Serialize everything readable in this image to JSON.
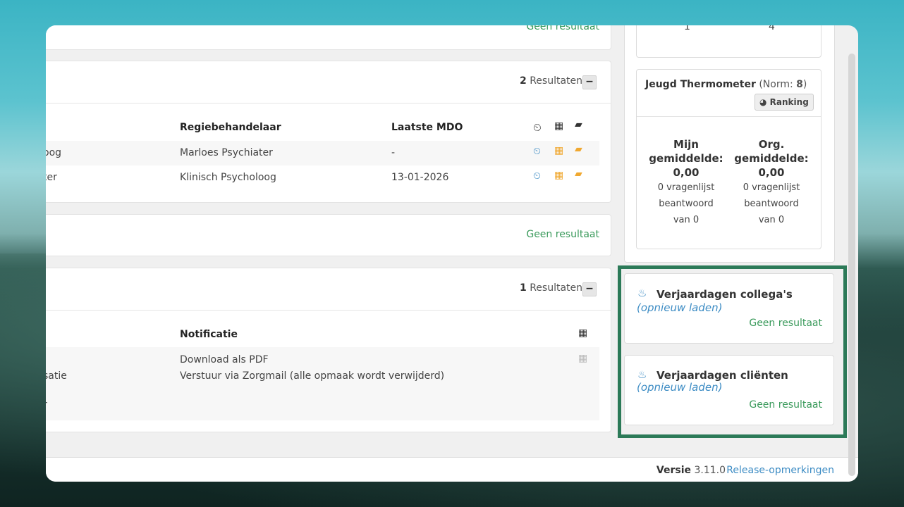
{
  "top_panel": {
    "status": "Geen resultaat"
  },
  "mdo_panel": {
    "count": "2",
    "count_label": "Resultaten",
    "collapse": "−",
    "headers": {
      "regie": "Regiebehandelaar",
      "laatste": "Laatste MDO"
    },
    "rows": [
      {
        "name_partial": "oog",
        "regie": "Marloes Psychiater",
        "laatste": "-"
      },
      {
        "name_partial": "ter",
        "regie": "Klinisch Psycholoog",
        "laatste": "13-01-2026"
      }
    ]
  },
  "empty_panel": {
    "status": "Geen resultaat"
  },
  "notif_panel": {
    "count": "1",
    "count_label": "Resultaten",
    "collapse": "−",
    "header": "Notificatie",
    "row": {
      "left_partial": "satie",
      "left_partial2": "r",
      "download": "Download als PDF",
      "zorgmail": "Verstuur via Zorgmail (alle opmaak wordt verwijderd)"
    }
  },
  "side_top": {
    "val1": "1",
    "val2": "4"
  },
  "thermometer": {
    "title": "Jeugd Thermometer",
    "norm_prefix": "(Norm: ",
    "norm_value": "8",
    "norm_suffix": ")",
    "ranking": "Ranking",
    "mine_label": "Mijn gemiddelde:",
    "mine_value": "0,00",
    "mine_sub": "0 vragenlijst beantwoord van 0",
    "org_label": "Org. gemiddelde:",
    "org_value": "0,00",
    "org_sub": "0 vragenlijst beantwoord van 0"
  },
  "bday_colleagues": {
    "title": "Verjaardagen collega's",
    "reload": "(opnieuw laden)",
    "status": "Geen resultaat"
  },
  "bday_clients": {
    "title": "Verjaardagen cliënten",
    "reload": "(opnieuw laden)",
    "status": "Geen resultaat"
  },
  "footer": {
    "version_label": "Versie",
    "version": "3.11.0",
    "release": "Release-opmerkingen"
  },
  "colors": {
    "accent_green": "#3a9a5b",
    "link_blue": "#3d8cc4",
    "highlight": "#2c7a58"
  }
}
